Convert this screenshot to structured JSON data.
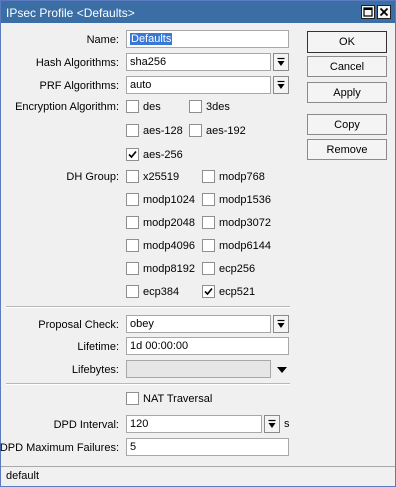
{
  "window": {
    "title": "IPsec Profile <Defaults>"
  },
  "fields": {
    "name": {
      "label": "Name:",
      "value": "Defaults"
    },
    "hash_algorithms": {
      "label": "Hash Algorithms:",
      "value": "sha256"
    },
    "prf_algorithms": {
      "label": "PRF Algorithms:",
      "value": "auto"
    },
    "encryption_algorithm": {
      "label": "Encryption Algorithm:",
      "options": [
        {
          "label": "des",
          "checked": false
        },
        {
          "label": "3des",
          "checked": false
        },
        {
          "label": "aes-128",
          "checked": false
        },
        {
          "label": "aes-192",
          "checked": false
        },
        {
          "label": "aes-256",
          "checked": true
        }
      ]
    },
    "dh_group": {
      "label": "DH Group:",
      "options": [
        {
          "label": "x25519",
          "checked": false
        },
        {
          "label": "modp768",
          "checked": false
        },
        {
          "label": "modp1024",
          "checked": false
        },
        {
          "label": "modp1536",
          "checked": false
        },
        {
          "label": "modp2048",
          "checked": false
        },
        {
          "label": "modp3072",
          "checked": false
        },
        {
          "label": "modp4096",
          "checked": false
        },
        {
          "label": "modp6144",
          "checked": false
        },
        {
          "label": "modp8192",
          "checked": false
        },
        {
          "label": "ecp256",
          "checked": false
        },
        {
          "label": "ecp384",
          "checked": false
        },
        {
          "label": "ecp521",
          "checked": true
        }
      ]
    },
    "proposal_check": {
      "label": "Proposal Check:",
      "value": "obey"
    },
    "lifetime": {
      "label": "Lifetime:",
      "value": "1d 00:00:00"
    },
    "lifebytes": {
      "label": "Lifebytes:",
      "value": ""
    },
    "nat_traversal": {
      "label": "NAT Traversal",
      "checked": false
    },
    "dpd_interval": {
      "label": "DPD Interval:",
      "value": "120",
      "unit": "s"
    },
    "dpd_maximum_failures": {
      "label": "DPD Maximum Failures:",
      "value": "5"
    }
  },
  "buttons": {
    "ok": "OK",
    "cancel": "Cancel",
    "apply": "Apply",
    "copy": "Copy",
    "remove": "Remove"
  },
  "status": {
    "text": "default"
  },
  "icons": {
    "maximize": "maximize-icon",
    "close": "close-icon",
    "dropdown": "dropdown-arrow-icon",
    "checkmark": "checkmark-icon"
  },
  "colors": {
    "title_bar": "#3a6ea5",
    "selection": "#3a78d7",
    "window_bg": "#f0f0f0"
  }
}
